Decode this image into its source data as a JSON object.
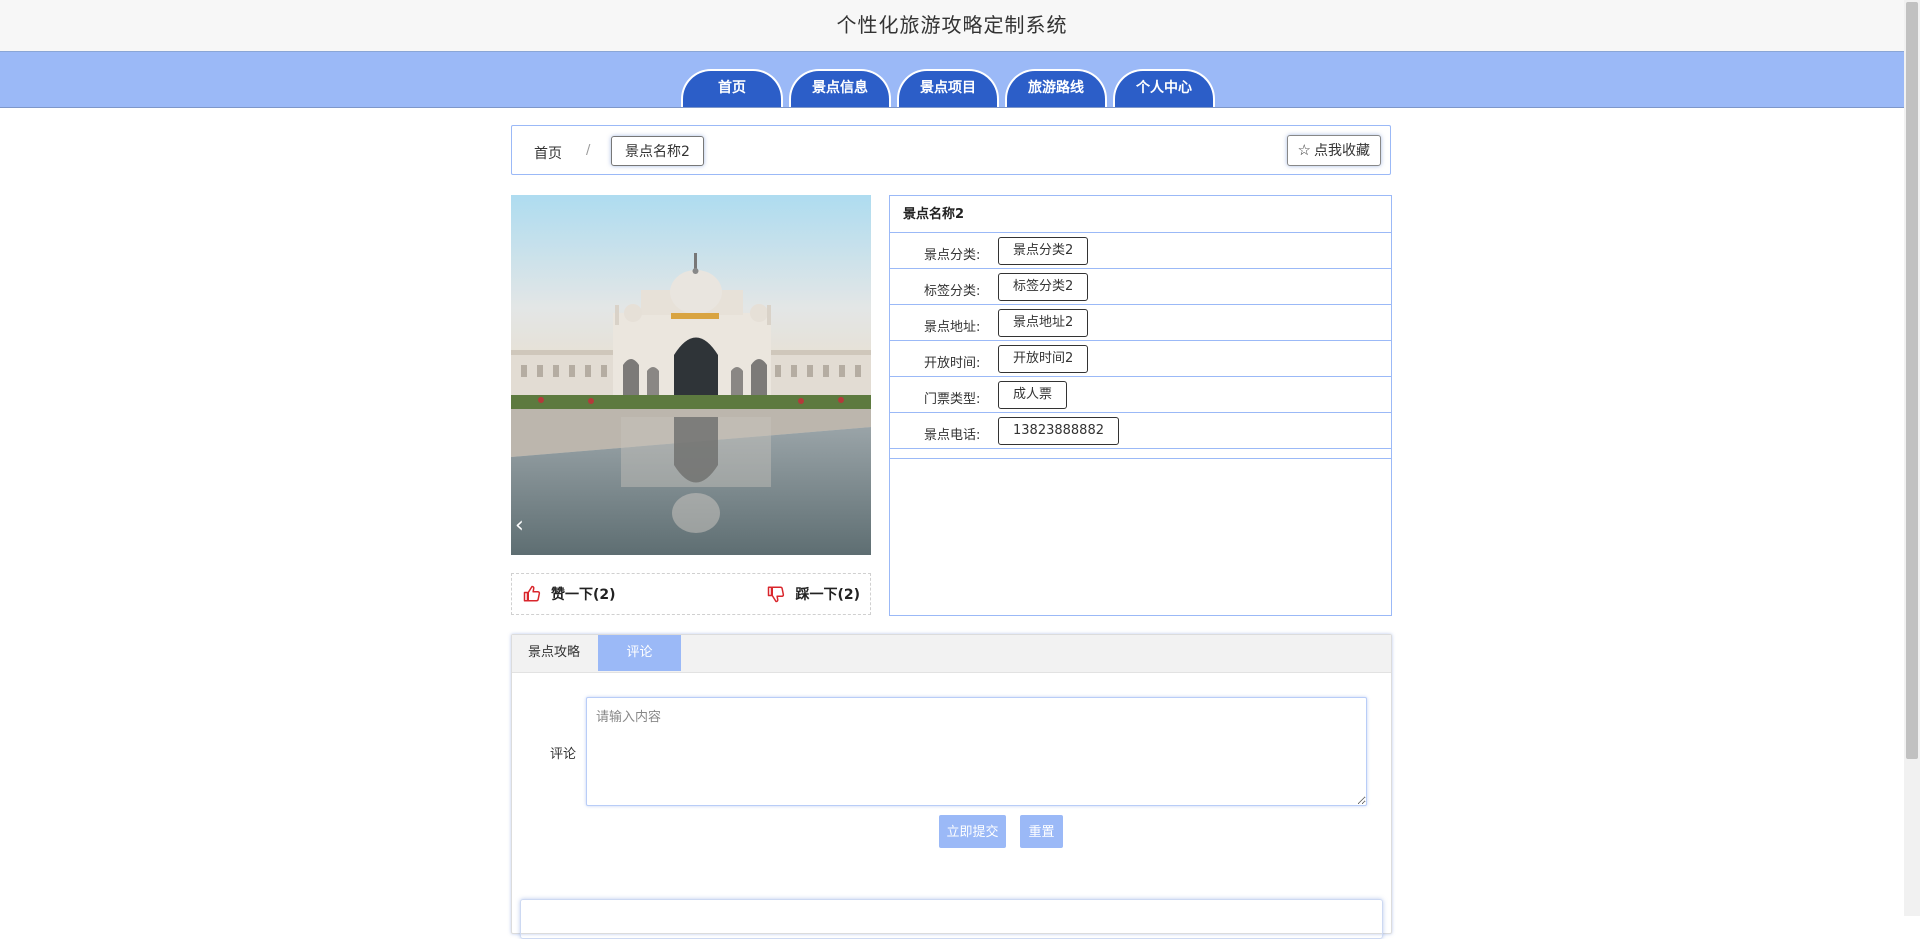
{
  "site": {
    "title": "个性化旅游攻略定制系统"
  },
  "nav": {
    "items": [
      "首页",
      "景点信息",
      "景点项目",
      "旅游路线",
      "个人中心"
    ]
  },
  "breadcrumb": {
    "home": "首页",
    "separator": "/",
    "current": "景点名称2"
  },
  "favorite": {
    "icon": "star-outline-icon",
    "label": "点我收藏"
  },
  "carousel": {
    "prev": "‹"
  },
  "vote": {
    "up_label": "赞一下(2)",
    "down_label": "踩一下(2)",
    "up_icon": "thumbs-up-icon",
    "down_icon": "thumbs-down-icon"
  },
  "detail": {
    "name": "景点名称2",
    "rows": [
      {
        "label": "景点分类:",
        "value": "景点分类2"
      },
      {
        "label": "标签分类:",
        "value": "标签分类2"
      },
      {
        "label": "景点地址:",
        "value": "景点地址2"
      },
      {
        "label": "开放时间:",
        "value": "开放时间2"
      },
      {
        "label": "门票类型:",
        "value": "成人票"
      },
      {
        "label": "景点电话:",
        "value": "13823888882"
      }
    ]
  },
  "tabs": {
    "items": [
      "景点攻略",
      "评论"
    ],
    "active": "评论"
  },
  "comment_form": {
    "label": "评论",
    "placeholder": "请输入内容",
    "submit_label": "立即提交",
    "reset_label": "重置"
  },
  "colors": {
    "nav_bg": "#9bb9f7",
    "nav_tab": "#2c5ec8",
    "accent": "#9bb9f7"
  }
}
